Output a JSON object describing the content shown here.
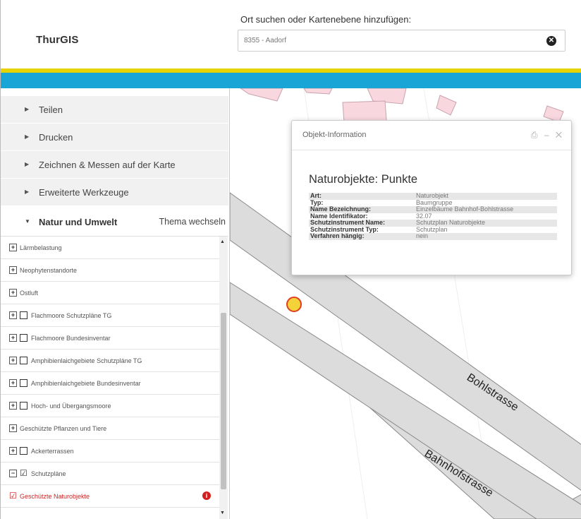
{
  "header": {
    "logo": "ThurGIS",
    "search_label": "Ort suchen oder Kartenebene hinzufügen:",
    "search_value": "8355 - Aadorf",
    "clear_icon": "x-circle-icon"
  },
  "colors": {
    "stripe_yellow": "#e6d300",
    "stripe_blue": "#19a6d7",
    "building_fill": "#f8d7df",
    "building_stroke": "#c9a3ad",
    "road_fill": "#dcdcdc",
    "accent_red": "#d21f1f"
  },
  "accordion": [
    {
      "label": "Teilen"
    },
    {
      "label": "Drucken"
    },
    {
      "label": "Zeichnen & Messen auf der Karte"
    },
    {
      "label": "Erweiterte Werkzeuge"
    }
  ],
  "active_section": {
    "label": "Natur und Umwelt",
    "theme_link": "Thema wechseln"
  },
  "layers": [
    {
      "label": "Lärmbelastung",
      "toggle": "+",
      "checkbox": false
    },
    {
      "label": "Neophytenstandorte",
      "toggle": "+",
      "checkbox": false
    },
    {
      "label": "Ostluft",
      "toggle": "+",
      "checkbox": false
    },
    {
      "label": "Flachmoore Schutzpläne TG",
      "toggle": "+",
      "checkbox": true
    },
    {
      "label": "Flachmoore Bundesinventar",
      "toggle": "+",
      "checkbox": true
    },
    {
      "label": "Amphibienlaichgebiete Schutzpläne TG",
      "toggle": "+",
      "checkbox": true
    },
    {
      "label": "Amphibienlaichgebiete Bundesinventar",
      "toggle": "+",
      "checkbox": true
    },
    {
      "label": "Hoch- und Übergangsmoore",
      "toggle": "+",
      "checkbox": true
    },
    {
      "label": "Geschützte Pflanzen und Tiere",
      "toggle": "+",
      "checkbox": false
    },
    {
      "label": "Ackerterrassen",
      "toggle": "+",
      "checkbox": true
    },
    {
      "label": "Schutzpläne",
      "toggle": "−",
      "checkbox": "checked"
    },
    {
      "label": "Geschützte Naturobjekte",
      "toggle": "",
      "checkbox": "checked",
      "active": true
    }
  ],
  "popup": {
    "title": "Objekt-Information",
    "tools": "⎙ – ✕",
    "heading": "Naturobjekte: Punkte",
    "rows": [
      {
        "key": "Art:",
        "value": "Naturobjekt"
      },
      {
        "key": "Typ:",
        "value": "Baumgruppe"
      },
      {
        "key": "Name Bezeichnung:",
        "value": "Einzelbäume Bahnhof-Bohlstrasse"
      },
      {
        "key": "Name Identifikator:",
        "value": "32.07"
      },
      {
        "key": "Schutzinstrument Name:",
        "value": "Schutzplan Naturobjekte"
      },
      {
        "key": "Schutzinstrument Typ:",
        "value": "Schutzplan"
      },
      {
        "key": "Verfahren hängig:",
        "value": "nein"
      }
    ]
  },
  "map": {
    "street_1": "Bohlstrasse",
    "street_2": "Bahnhofstrasse"
  }
}
